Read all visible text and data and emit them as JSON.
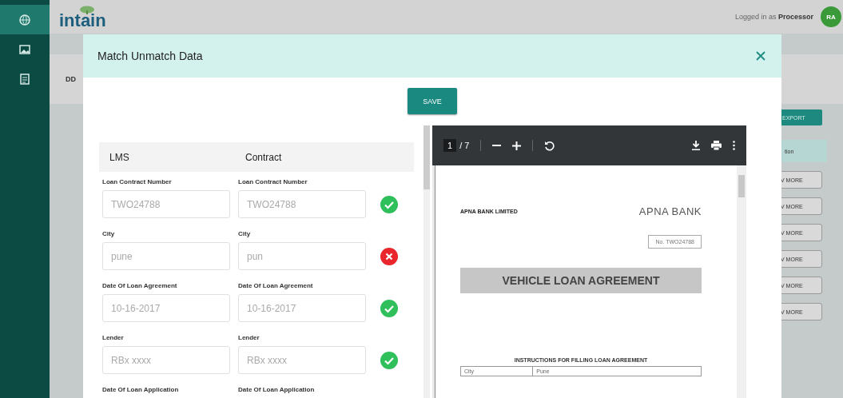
{
  "sidebar": {
    "items": [
      {
        "kind": "globe",
        "selected": true
      },
      {
        "kind": "image",
        "selected": false
      },
      {
        "kind": "document",
        "selected": false
      }
    ]
  },
  "header": {
    "logo": "intain",
    "user_text": "Logged in as **Processor**",
    "avatar": "RA"
  },
  "background": {
    "breadcrumb": "DD",
    "export_button": "EXPORT",
    "column_header": "tion",
    "row_buttons": [
      "V MORE",
      "V MORE",
      "V MORE",
      "V MORE",
      "V MORE",
      "V MORE"
    ]
  },
  "modal": {
    "title": "Match Unmatch Data",
    "save_button": "SAVE",
    "form": {
      "columns": [
        "LMS",
        "Contract"
      ],
      "rows": [
        {
          "lms_label": "Loan Contract Number",
          "contract_label": "Loan Contract Number",
          "lms_value": "TWO24788",
          "contract_value": "TWO24788",
          "match": true
        },
        {
          "lms_label": "City",
          "contract_label": "City",
          "lms_value": "pune",
          "contract_value": "pun",
          "match": false
        },
        {
          "lms_label": "Date Of Loan Agreement",
          "contract_label": "Date Of Loan Agreement",
          "lms_value": "10-16-2017",
          "contract_value": "10-16-2017",
          "match": true
        },
        {
          "lms_label": "Lender",
          "contract_label": "Lender",
          "lms_value": "RBx xxxx",
          "contract_value": "RBx xxxx",
          "match": true
        },
        {
          "lms_label": "Date Of Loan Application",
          "contract_label": "Date Of Loan Application"
        }
      ]
    },
    "pdf": {
      "page_current": "1",
      "page_count": "/ 7",
      "document": {
        "company": "APNA BANK LIMITED",
        "brand": "APNA BANK",
        "number": "No. TWO24788",
        "title": "VEHICLE LOAN AGREEMENT",
        "instructions": "INSTRUCTIONS FOR FILLING LOAN AGREEMENT",
        "table_rows": [
          [
            "City",
            "Pune"
          ]
        ]
      }
    }
  }
}
